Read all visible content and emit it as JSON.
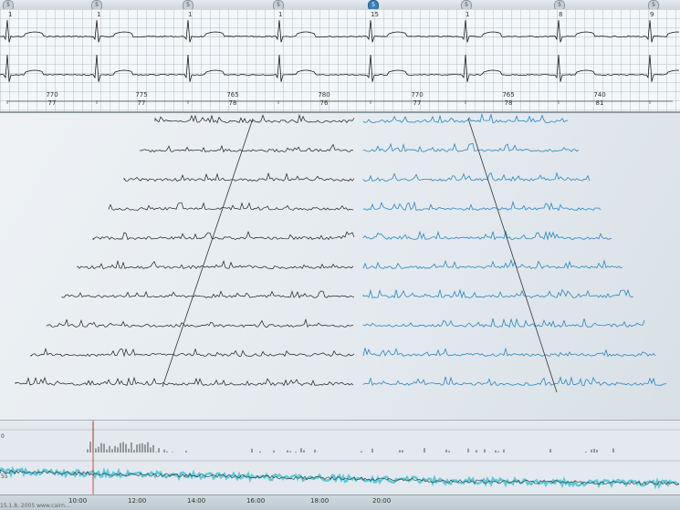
{
  "colors": {
    "trace_black": "#1c1c1c",
    "trace_blue": "#2a86c4",
    "cyan_trend": "#5ec9d8",
    "spike_color": "#222222"
  },
  "markers": [
    "5",
    "5",
    "5",
    "5",
    "5",
    "5",
    "5",
    "5"
  ],
  "active_marker_index": 3,
  "beat_labels": [
    "1",
    "1",
    "1",
    "1",
    "15",
    "1",
    "8",
    "9"
  ],
  "rr_intervals": [
    {
      "ms": "770",
      "hr": "77"
    },
    {
      "ms": "775",
      "hr": "77"
    },
    {
      "ms": "765",
      "hr": "78"
    },
    {
      "ms": "780",
      "hr": "76"
    },
    {
      "ms": "770",
      "hr": "77"
    },
    {
      "ms": "765",
      "hr": "78"
    },
    {
      "ms": "740",
      "hr": "81"
    }
  ],
  "side_labels": [
    "0",
    "55"
  ],
  "time_labels": [
    "10:00",
    "12:00",
    "14:00",
    "16:00",
    "18:00",
    "20:00"
  ],
  "footer": "15.1.8. 2005 www.cairn..."
}
